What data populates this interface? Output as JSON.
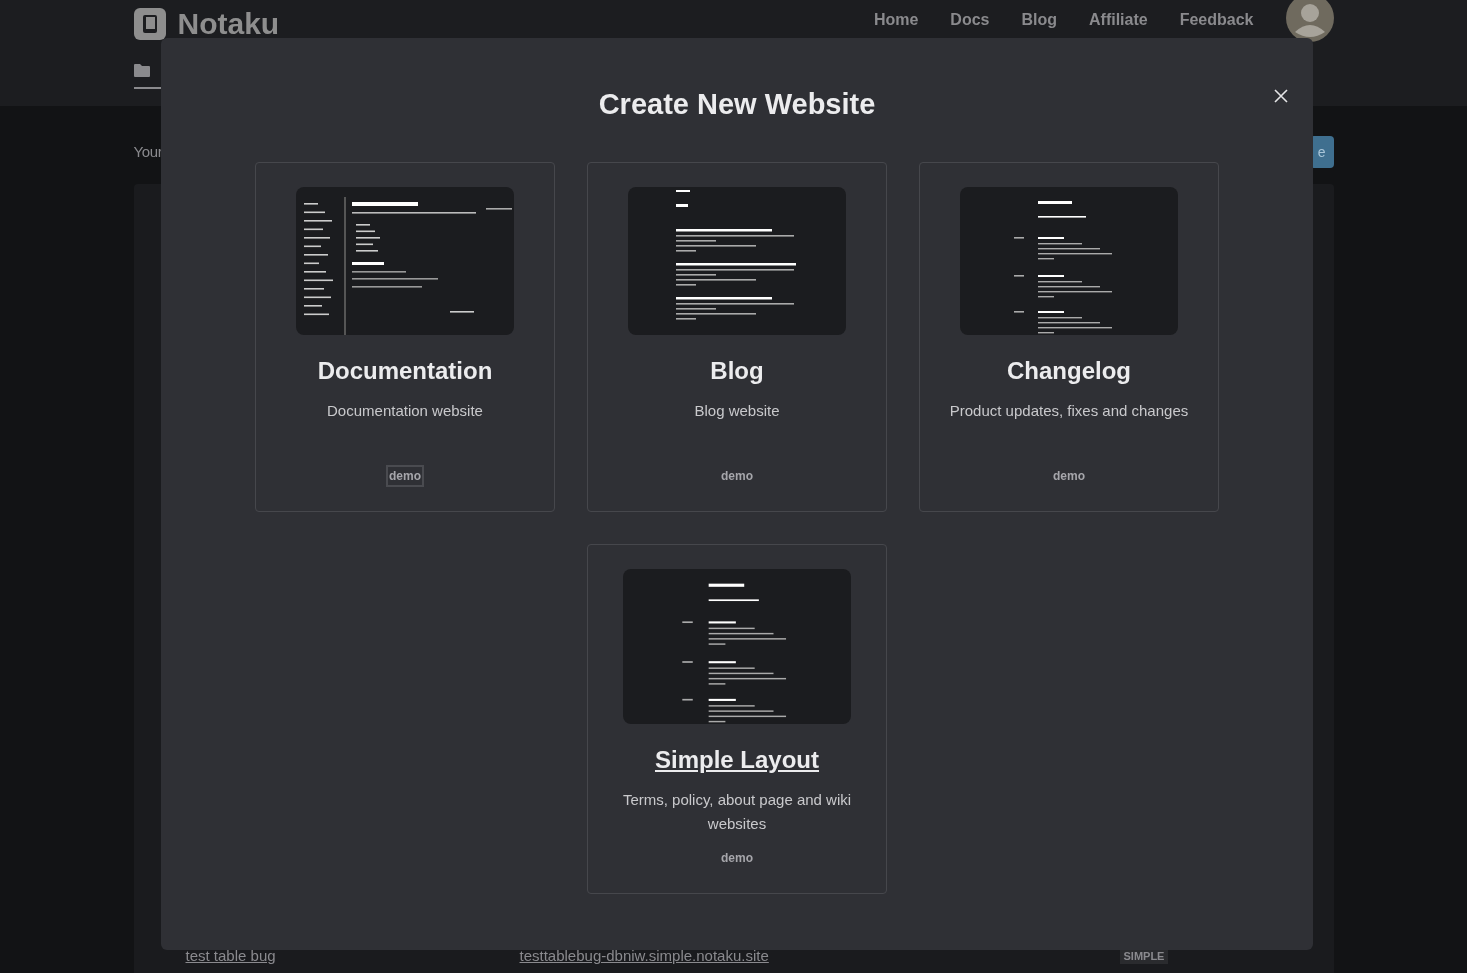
{
  "header": {
    "logo": "Notaku",
    "nav": [
      "Home",
      "Docs",
      "Blog",
      "Affiliate",
      "Feedback"
    ]
  },
  "page": {
    "heading": "Your",
    "button": "e",
    "rows": [
      {
        "name": "test table bug",
        "domain": "testtablebug-dbniw.simple.notaku.site",
        "badge": "SIMPLE"
      }
    ]
  },
  "modal": {
    "title": "Create New Website",
    "templates": [
      {
        "kind": "docs",
        "title": "Documentation",
        "description": "Documentation website",
        "demo": "demo",
        "demo_focused": true,
        "title_hovered": false
      },
      {
        "kind": "blog",
        "title": "Blog",
        "description": "Blog website",
        "demo": "demo",
        "demo_focused": false,
        "title_hovered": false
      },
      {
        "kind": "changelog",
        "title": "Changelog",
        "description": "Product updates, fixes and changes",
        "demo": "demo",
        "demo_focused": false,
        "title_hovered": false
      },
      {
        "kind": "simple",
        "title": "Simple Layout",
        "description": "Terms, policy, about page and wiki websites",
        "demo": "demo",
        "demo_focused": false,
        "title_hovered": true
      }
    ]
  }
}
